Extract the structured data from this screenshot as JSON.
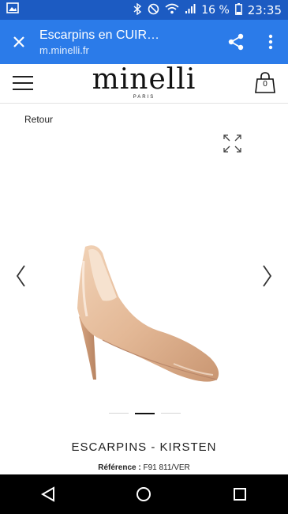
{
  "status_bar": {
    "battery_percent": "16 %",
    "time": "23:35",
    "icons": [
      "image-notification-icon",
      "bluetooth-icon",
      "do-not-disturb-icon",
      "wifi-icon",
      "cell-signal-icon",
      "battery-icon"
    ]
  },
  "toolbar": {
    "title": "Escarpins en CUIR…",
    "url": "m.minelli.fr",
    "close_icon": "close-icon",
    "share_icon": "share-icon",
    "menu_icon": "more-vert-icon"
  },
  "site_header": {
    "logo": "minelli",
    "logo_sub": "PARIS",
    "cart_count": "0"
  },
  "product": {
    "back_label": "Retour",
    "title": "ESCARPINS - KIRSTEN",
    "reference_label": "Référence :",
    "reference_value": "F91 811/VER",
    "image_name": "nude-patent-pump",
    "carousel": {
      "count": 3,
      "active_index": 1
    }
  },
  "colors": {
    "status_bar": "#1c5bc2",
    "toolbar": "#2b7be9",
    "shoe": "#e3b896"
  }
}
